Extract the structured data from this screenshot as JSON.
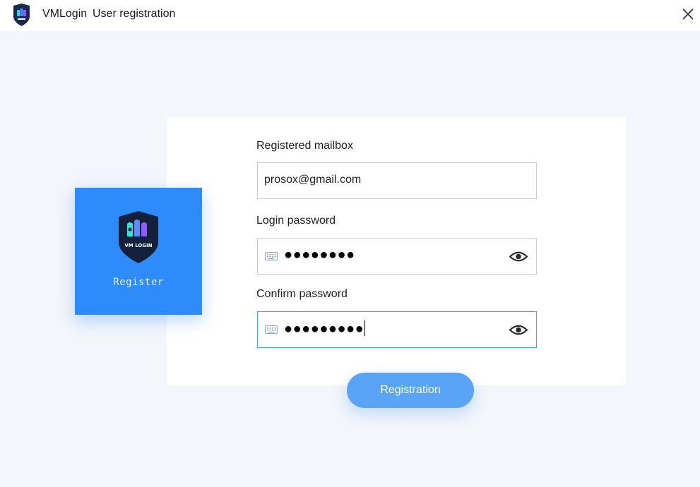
{
  "titlebar": {
    "app_name": "VMLogin",
    "window_title": "User registration",
    "logo_icon": "vmlogin-shield-icon",
    "close_icon": "close-icon"
  },
  "brand_tile": {
    "label": "Register",
    "logo_icon": "vmlogin-shield-icon",
    "color": "#2e8bfb"
  },
  "form": {
    "email": {
      "label": "Registered mailbox",
      "value": "prosox@gmail.com"
    },
    "password": {
      "label": "Login password",
      "masked_value": "●●●●●●●●",
      "keyboard_icon": "keyboard-icon",
      "toggle_icon": "eye-icon"
    },
    "confirm_password": {
      "label": "Confirm password",
      "masked_value": "●●●●●●●●●",
      "keyboard_icon": "keyboard-icon",
      "toggle_icon": "eye-icon",
      "focused": true
    },
    "submit_label": "Registration",
    "accent_color": "#5aa4f8"
  }
}
